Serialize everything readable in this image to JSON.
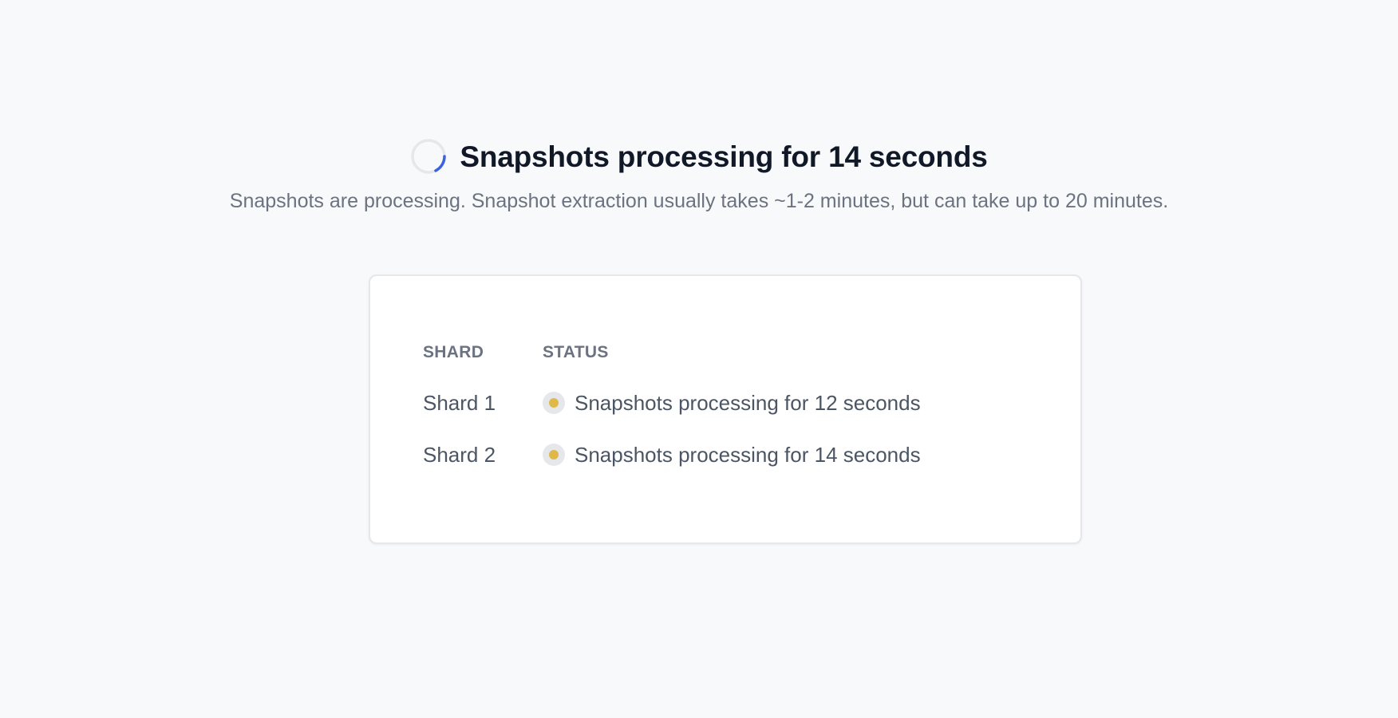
{
  "header": {
    "title": "Snapshots processing for 14 seconds",
    "subtitle": "Snapshots are processing. Snapshot extraction usually takes ~1-2 minutes, but can take up to 20 minutes.",
    "spinner_icon": "loading-spinner-icon",
    "spinner_colors": {
      "track": "#e5e7eb",
      "arc": "#3b63e0"
    }
  },
  "shards_table": {
    "columns": {
      "shard": "SHARD",
      "status": "STATUS"
    },
    "rows": [
      {
        "shard": "Shard 1",
        "status": "Snapshots processing for 12 seconds",
        "status_icon": "pending-status-dot-icon",
        "status_color": "#e0b84a"
      },
      {
        "shard": "Shard 2",
        "status": "Snapshots processing for 14 seconds",
        "status_icon": "pending-status-dot-icon",
        "status_color": "#e0b84a"
      }
    ]
  }
}
